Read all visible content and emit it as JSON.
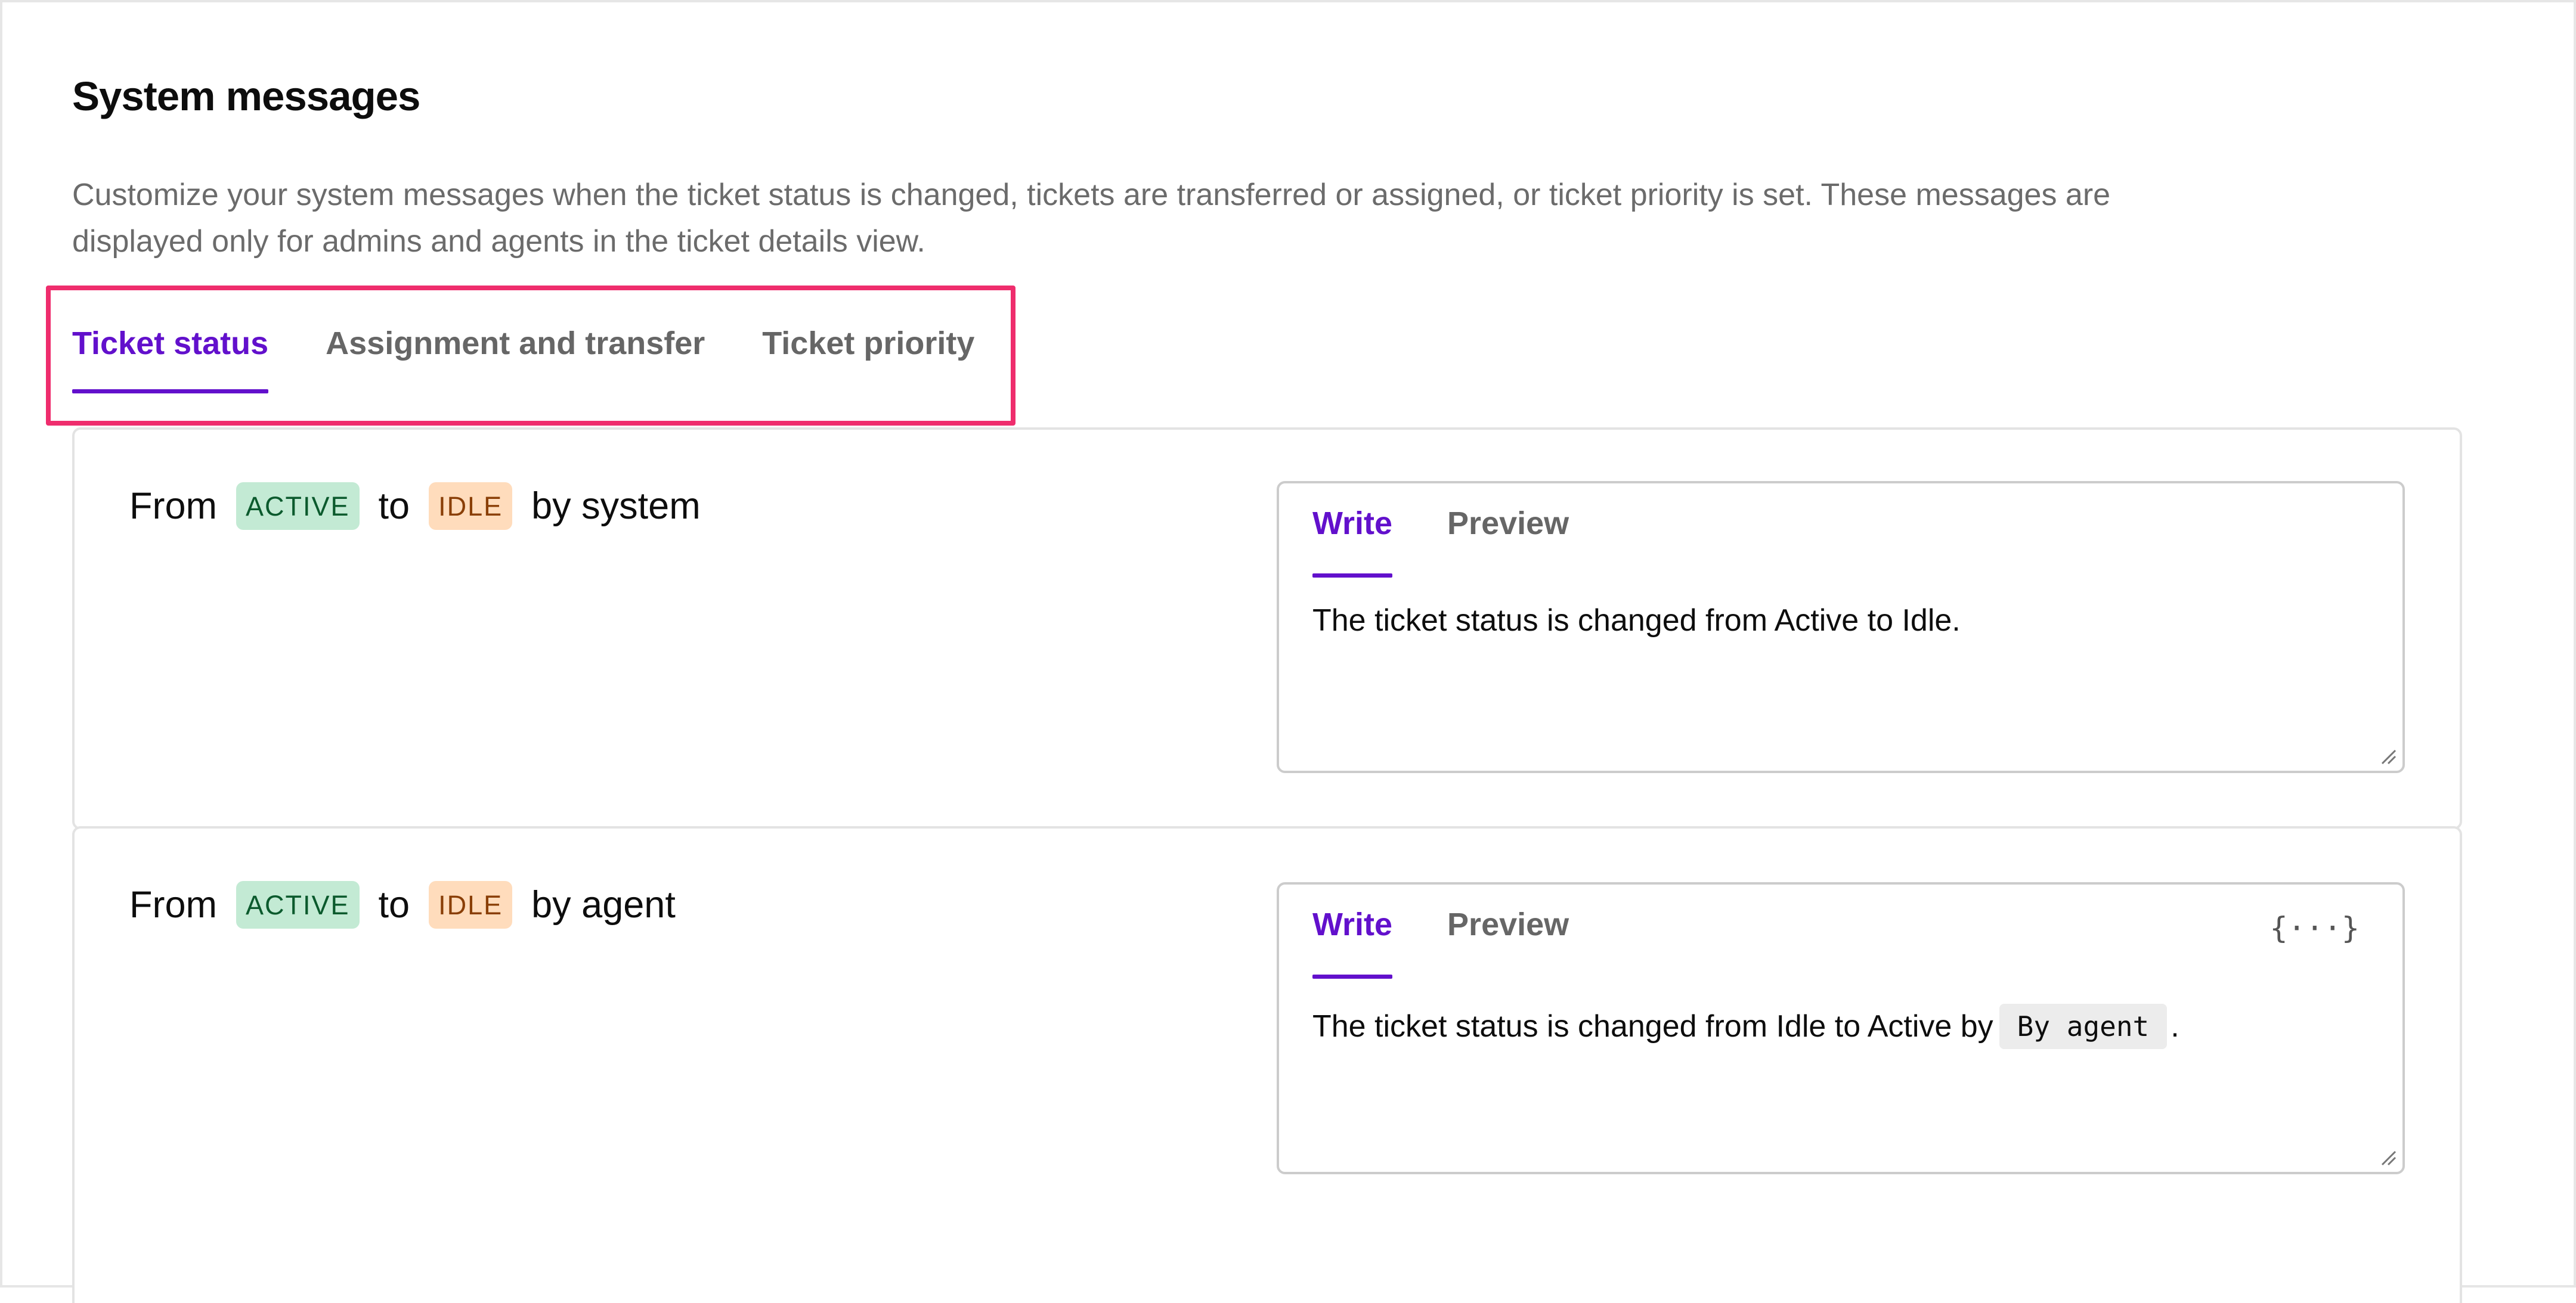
{
  "page": {
    "title": "System messages",
    "description": "Customize your system messages when the ticket status is changed, tickets are transferred or assigned, or ticket priority is set. These messages are displayed only for admins and agents in the ticket details view."
  },
  "tabs": [
    {
      "label": "Ticket status",
      "active": true
    },
    {
      "label": "Assignment and transfer",
      "active": false
    },
    {
      "label": "Ticket priority",
      "active": false
    }
  ],
  "rules": [
    {
      "from_label": "From",
      "from_status": "ACTIVE",
      "to_label": "to",
      "to_status": "IDLE",
      "by_label": "by system",
      "editor": {
        "write_tab": "Write",
        "preview_tab": "Preview",
        "text": "The ticket status is changed from Active to Idle.",
        "variable": "",
        "suffix": ""
      }
    },
    {
      "from_label": "From",
      "from_status": "ACTIVE",
      "to_label": "to",
      "to_status": "IDLE",
      "by_label": "by agent",
      "editor": {
        "write_tab": "Write",
        "preview_tab": "Preview",
        "text": "The ticket status is changed from Idle to Active by",
        "variable": "By agent",
        "suffix": ".",
        "variable_icon": "{···}"
      }
    }
  ],
  "colors": {
    "accent": "#6210cc",
    "highlight": "#ef2d6d",
    "active_badge_bg": "#c3ead4",
    "active_badge_text": "#0b5a2d",
    "idle_badge_bg": "#ffdcbc",
    "idle_badge_text": "#8a3f07"
  },
  "icons": {
    "variable_insert": "braces-icon",
    "resize": "resize-handle-icon"
  }
}
